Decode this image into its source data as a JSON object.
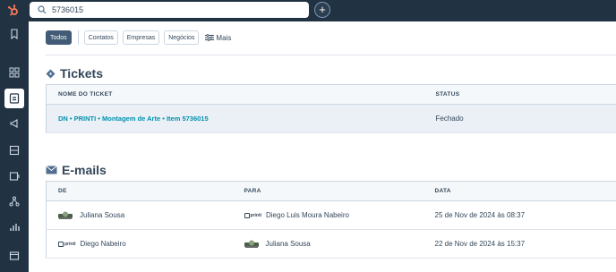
{
  "search": {
    "value": "5736015"
  },
  "filters": {
    "todos": "Todos",
    "contatos": "Contatos",
    "empresas": "Empresas",
    "negocios": "Negócios",
    "mais": "Mais"
  },
  "tickets": {
    "title": "Tickets",
    "columns": [
      "NOME DO TICKET",
      "STATUS"
    ],
    "rows": [
      {
        "name": "DN • PRINTI • Montagem de Arte • Item 5736015",
        "status": "Fechado"
      }
    ]
  },
  "emails": {
    "title": "E-mails",
    "columns": [
      "DE",
      "PARA",
      "DATA"
    ],
    "rows": [
      {
        "from": "Juliana Sousa",
        "to": "Diego Luis Moura Nabeiro",
        "date": "25 de Nov de 2024 às 08:37"
      },
      {
        "from": "Diego Nabeiro",
        "to": "Juliana Sousa",
        "date": "22 de Nov de 2024 às 15:37"
      }
    ]
  },
  "logos": {
    "printi": "printi"
  },
  "colors": {
    "nav": "#213343",
    "brand": "#ff7a59",
    "link": "#0091ae",
    "chip_active": "#425b76"
  }
}
